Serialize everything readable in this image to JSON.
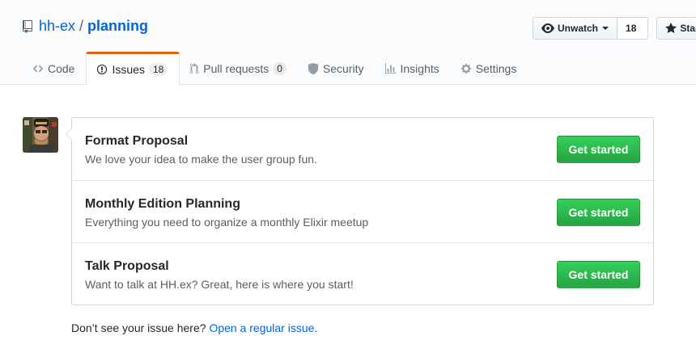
{
  "repo": {
    "owner": "hh-ex",
    "separator": "/",
    "name": "planning"
  },
  "actions": {
    "watch_label": "Unwatch",
    "watch_count": "18",
    "star_label": "Star"
  },
  "tabs": [
    {
      "label": "Code",
      "icon": "code-icon"
    },
    {
      "label": "Issues",
      "count": "18",
      "icon": "issue-opened-icon",
      "selected": true
    },
    {
      "label": "Pull requests",
      "count": "0",
      "icon": "git-pull-request-icon"
    },
    {
      "label": "Security",
      "icon": "shield-icon"
    },
    {
      "label": "Insights",
      "icon": "graph-icon"
    },
    {
      "label": "Settings",
      "icon": "gear-icon"
    }
  ],
  "templates": [
    {
      "title": "Format Proposal",
      "description": "We love your idea to make the user group fun.",
      "button": "Get started"
    },
    {
      "title": "Monthly Edition Planning",
      "description": "Everything you need to organize a monthly Elixir meetup",
      "button": "Get started"
    },
    {
      "title": "Talk Proposal",
      "description": "Want to talk at HH.ex? Great, here is where you start!",
      "button": "Get started"
    }
  ],
  "footer": {
    "text": "Don’t see your issue here?",
    "link": "Open a regular issue."
  },
  "colors": {
    "link": "#0366d6",
    "accent_tab": "#e36209",
    "primary_button": "#28a745"
  }
}
